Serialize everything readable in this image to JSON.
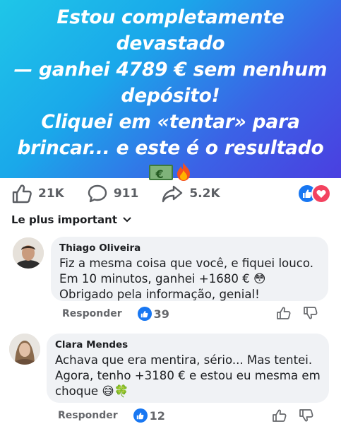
{
  "hero": {
    "line1": "Estou completamente devastado",
    "line2": "— ganhei 4789 € sem nenhum",
    "line3": "depósito!",
    "line4": "Cliquei em «tentar» para",
    "line5": "brincar... e este é o resultado",
    "emojis": [
      "money-icon",
      "fire-icon"
    ]
  },
  "stats": {
    "likes": "21K",
    "comments": "911",
    "shares": "5.2K"
  },
  "sort": {
    "label": "Le plus important"
  },
  "comments": [
    {
      "author": "Thiago Oliveira",
      "lines": [
        "Fiz a mesma coisa que você, e fiquei louco.",
        "Em 10 minutos, ganhei +1680 € 😳",
        "Obrigado pela informação, genial!"
      ],
      "reply_label": "Responder",
      "like_count": "39"
    },
    {
      "author": "Clara Mendes",
      "lines": [
        "Achava que era mentira, sério... Mas tentei.",
        "Agora, tenho +3180 € e estou eu mesma em",
        "choque 😅🍀"
      ],
      "reply_label": "Responder",
      "like_count": "12"
    }
  ],
  "colors": {
    "accent": "#1877f2",
    "love": "#f3425f",
    "bubble": "#f0f2f5"
  }
}
